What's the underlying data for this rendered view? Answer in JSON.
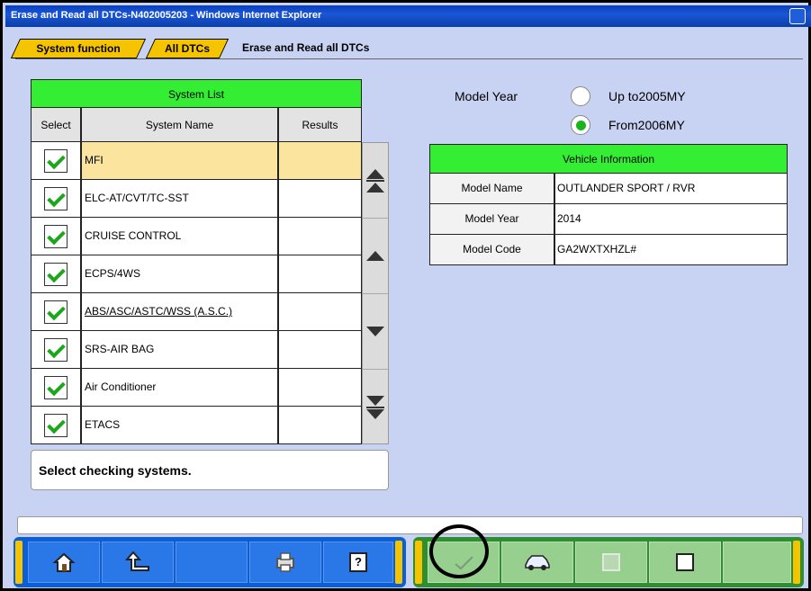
{
  "window": {
    "title": "Erase and Read all DTCs-N402005203 - Windows Internet Explorer"
  },
  "breadcrumb": {
    "items": [
      "System function",
      "All DTCs"
    ],
    "current": "Erase and Read all DTCs"
  },
  "system_list": {
    "title": "System List",
    "columns": {
      "select": "Select",
      "name": "System Name",
      "results": "Results"
    },
    "rows": [
      {
        "name": "MFI",
        "checked": true,
        "result": "",
        "selected": true
      },
      {
        "name": "ELC-AT/CVT/TC-SST",
        "checked": true,
        "result": ""
      },
      {
        "name": "CRUISE CONTROL",
        "checked": true,
        "result": ""
      },
      {
        "name": "ECPS/4WS",
        "checked": true,
        "result": ""
      },
      {
        "name": "ABS/ASC/ASTC/WSS (A.S.C.)",
        "checked": true,
        "result": ""
      },
      {
        "name": "SRS-AIR BAG",
        "checked": true,
        "result": ""
      },
      {
        "name": "Air Conditioner",
        "checked": true,
        "result": ""
      },
      {
        "name": "ETACS",
        "checked": true,
        "result": ""
      }
    ]
  },
  "message": "Select checking systems.",
  "model_year": {
    "label": "Model Year",
    "options": [
      {
        "label": "Up to2005MY",
        "selected": false
      },
      {
        "label": "From2006MY",
        "selected": true
      }
    ]
  },
  "vehicle_info": {
    "title": "Vehicle Information",
    "rows": [
      {
        "label": "Model Name",
        "value": "OUTLANDER SPORT / RVR"
      },
      {
        "label": "Model Year",
        "value": "2014"
      },
      {
        "label": "Model Code",
        "value": "GA2WXTXHZL#"
      }
    ]
  },
  "toolbar": {
    "help_label": "?",
    "icons": [
      "home-icon",
      "back-icon",
      "blank",
      "printer-icon",
      "help-icon",
      "checkmark-icon",
      "vehicle-icon",
      "check-all-icon",
      "uncheck-all-icon",
      "blank"
    ]
  },
  "colors": {
    "green_header": "#33ee33",
    "selected_row": "#fbe49d",
    "toolbar_blue": "#0a5fd8",
    "toolbar_green": "#96cf8e",
    "tab_yellow": "#f5c400"
  }
}
